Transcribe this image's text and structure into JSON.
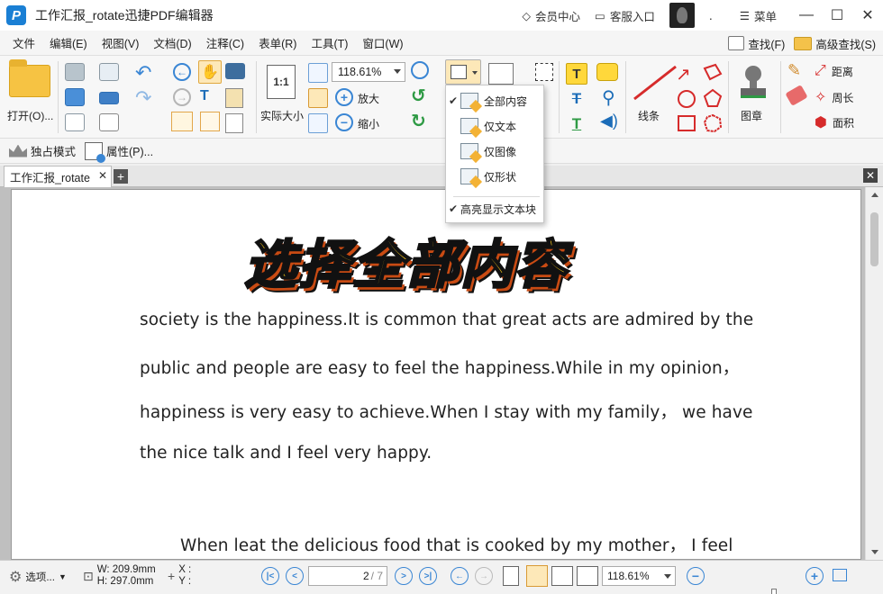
{
  "titlebar": {
    "logo_letter": "P",
    "title": "工作汇报_rotate迅捷PDF编辑器",
    "member_center": "会员中心",
    "customer_login": "客服入口",
    "dot": ".",
    "menu_label": "菜单"
  },
  "menubar": {
    "items": [
      "文件",
      "编辑(E)",
      "视图(V)",
      "文档(D)",
      "注释(C)",
      "表单(R)",
      "工具(T)",
      "窗口(W)"
    ],
    "find": "查找(F)",
    "advanced_find": "高级查找(S)"
  },
  "ribbon": {
    "open": "打开(O)...",
    "actual_size": "实际大小",
    "actual_size_glyph": "1:1",
    "zoom_value": "118.61%",
    "zoom_in": "放大",
    "zoom_out": "缩小",
    "line": "线条",
    "stamp": "图章",
    "distance": "距离",
    "perimeter": "周长",
    "area": "面积"
  },
  "subbar": {
    "exclusive_mode": "独占模式",
    "properties": "属性(P)..."
  },
  "tabs": {
    "doc_tab": "工作汇报_rotate"
  },
  "dropdown": {
    "items": [
      {
        "label": "全部内容",
        "checked": true
      },
      {
        "label": "仅文本",
        "checked": false
      },
      {
        "label": "仅图像",
        "checked": false
      },
      {
        "label": "仅形状",
        "checked": false
      }
    ],
    "highlight_text_blocks": {
      "label": "高亮显示文本块",
      "checked": true
    }
  },
  "document": {
    "heading": "选择全部内容",
    "lines": [
      "society is the happiness.It is common that great acts are admired by the",
      "public and people are easy to feel the happiness.While in my opinion，",
      "happiness is very easy to achieve.When I stay with my family，  we have",
      "the nice talk and I feel very happy.",
      "When leat the delicious food that is cooked by my mother，  I feel"
    ]
  },
  "statusbar": {
    "options": "选项...",
    "width": "W: 209.9mm",
    "height": "H: 297.0mm",
    "x": "X :",
    "y": "Y :",
    "page_current": "2",
    "page_total": "/ 7",
    "zoom_value": "118.61%"
  },
  "colors": {
    "accent_blue": "#3a86d4",
    "highlight_orange": "#fde8b8",
    "heading_yellow": "#ffce1a",
    "annotation_red": "#d62b2b"
  }
}
